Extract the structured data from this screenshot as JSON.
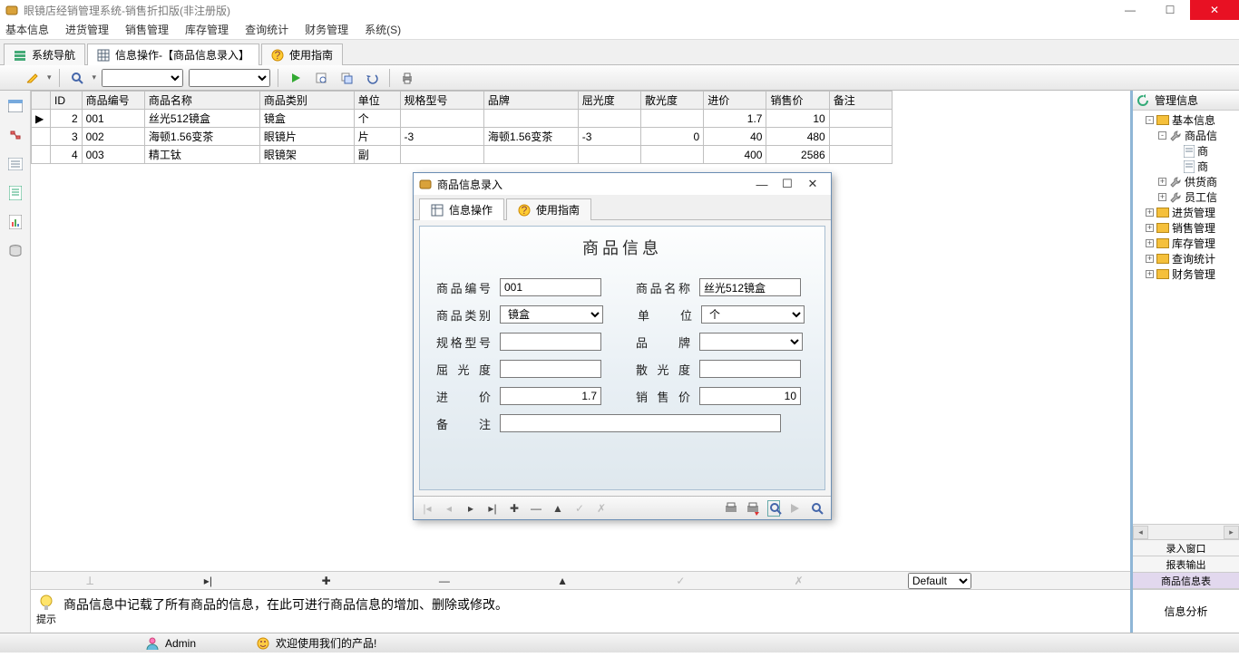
{
  "window": {
    "title": "眼镜店经销管理系统-销售折扣版(非注册版)"
  },
  "menu": [
    "基本信息",
    "进货管理",
    "销售管理",
    "库存管理",
    "查询统计",
    "财务管理",
    "系统(S)"
  ],
  "tabs": [
    {
      "label": "系统导航"
    },
    {
      "label": "信息操作-【商品信息录入】"
    },
    {
      "label": "使用指南"
    }
  ],
  "toolbar": {
    "combo1_value": "",
    "combo2_value": ""
  },
  "grid": {
    "headers": [
      "",
      "ID",
      "商品编号",
      "商品名称",
      "商品类别",
      "单位",
      "规格型号",
      "品牌",
      "屈光度",
      "散光度",
      "进价",
      "销售价",
      "备注"
    ],
    "rows": [
      {
        "mark": "▶",
        "id": "2",
        "code": "001",
        "name": "丝光512镜盒",
        "cat": "镜盒",
        "unit": "个",
        "spec": "",
        "brand": "",
        "qu": "",
        "san": "",
        "cost": "1.7",
        "price": "10",
        "note": ""
      },
      {
        "mark": "",
        "id": "3",
        "code": "002",
        "name": "海顿1.56变茶",
        "cat": "眼镜片",
        "unit": "片",
        "spec": "-3",
        "brand": "海顿1.56变茶",
        "qu": "-3",
        "san": "0",
        "cost": "40",
        "price": "480",
        "note": ""
      },
      {
        "mark": "",
        "id": "4",
        "code": "003",
        "name": "精工钛",
        "cat": "眼镜架",
        "unit": "副",
        "spec": "",
        "brand": "",
        "qu": "",
        "san": "",
        "cost": "400",
        "price": "2586",
        "note": ""
      }
    ]
  },
  "navselect": "Default",
  "hint": {
    "label": "提示",
    "text": "商品信息中记载了所有商品的信息，在此可进行商品信息的增加、删除或修改。"
  },
  "right": {
    "title": "管理信息",
    "tree": [
      {
        "lvl": 1,
        "exp": "-",
        "icon": "folder",
        "label": "基本信息"
      },
      {
        "lvl": 2,
        "exp": "-",
        "icon": "wrench",
        "label": "商品信"
      },
      {
        "lvl": 3,
        "exp": "",
        "icon": "doc",
        "label": "商"
      },
      {
        "lvl": 3,
        "exp": "",
        "icon": "doc",
        "label": "商"
      },
      {
        "lvl": 2,
        "exp": "+",
        "icon": "wrench",
        "label": "供货商"
      },
      {
        "lvl": 2,
        "exp": "+",
        "icon": "wrench",
        "label": "员工信"
      },
      {
        "lvl": 1,
        "exp": "+",
        "icon": "folder",
        "label": "进货管理"
      },
      {
        "lvl": 1,
        "exp": "+",
        "icon": "folder",
        "label": "销售管理"
      },
      {
        "lvl": 1,
        "exp": "+",
        "icon": "folder",
        "label": "库存管理"
      },
      {
        "lvl": 1,
        "exp": "+",
        "icon": "folder",
        "label": "查询统计"
      },
      {
        "lvl": 1,
        "exp": "+",
        "icon": "folder",
        "label": "财务管理"
      }
    ],
    "tabs": [
      "录入窗口",
      "报表输出",
      "商品信息表"
    ],
    "tabs_selected": 2,
    "bottom": "信息分析"
  },
  "status": {
    "user": "Admin",
    "msg": "欢迎使用我们的产品!"
  },
  "dialog": {
    "title": "商品信息录入",
    "tabs": [
      "信息操作",
      "使用指南"
    ],
    "form_title": "商品信息",
    "fields": {
      "code_label": "商品编号",
      "code": "001",
      "name_label": "商品名称",
      "name": "丝光512镜盒",
      "cat_label": "商品类别",
      "cat": "镜盒",
      "unit_label": "单　　位",
      "unit": "个",
      "spec_label": "规格型号",
      "spec": "",
      "brand_label": "品　　牌",
      "brand": "",
      "qu_label": "屈 光 度",
      "qu": "",
      "san_label": "散 光 度",
      "san": "",
      "cost_label": "进　　价",
      "cost": "1.7",
      "price_label": "销 售 价",
      "price": "10",
      "note_label": "备　　注",
      "note": ""
    }
  }
}
